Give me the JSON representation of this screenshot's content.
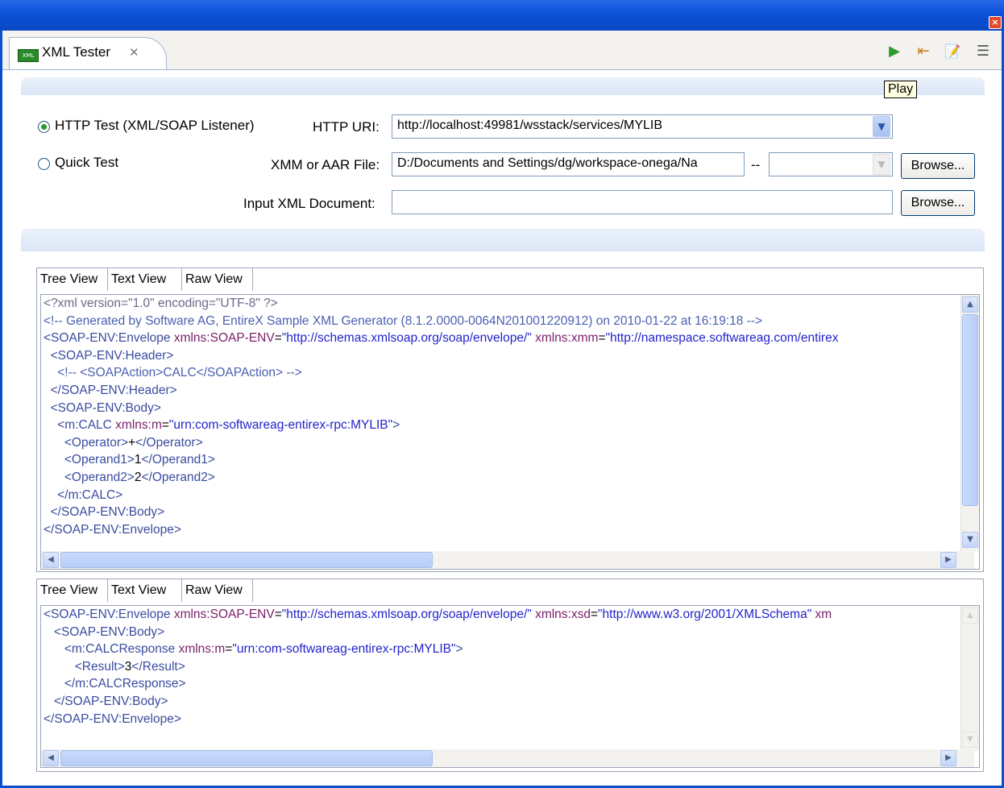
{
  "window": {
    "close_glyph": "×"
  },
  "tab": {
    "label": "XML Tester",
    "close_glyph": "✕",
    "icon": "xml-file-icon",
    "icon_text": "XML"
  },
  "toolbar": {
    "items": [
      {
        "name": "play-icon",
        "glyph": "▶"
      },
      {
        "name": "step-back-icon",
        "glyph": "⇤"
      },
      {
        "name": "export-icon",
        "glyph": "📝"
      },
      {
        "name": "layout-icon",
        "glyph": "☰"
      }
    ],
    "tooltip": "Play"
  },
  "form": {
    "radio_http": {
      "label": "HTTP Test (XML/SOAP Listener)",
      "checked": true
    },
    "radio_quick": {
      "label": "Quick Test",
      "checked": false
    },
    "http_uri_label": "HTTP URI:",
    "http_uri_value": "http://localhost:49981/wsstack/services/MYLIB",
    "xmm_label": "XMM or AAR File:",
    "xmm_value": "D:/Documents and Settings/dg/workspace-onega/Na",
    "xmm_separator": "--",
    "xmm_secondary_value": "",
    "input_xml_label": "Input XML Document:",
    "input_xml_value": "",
    "browse_label": "Browse..."
  },
  "request_panel": {
    "tabs": [
      "Tree View",
      "Text View",
      "Raw View"
    ],
    "lines": [
      [
        [
          "pi",
          "<?xml version=\"1.0\" encoding=\"UTF-8\" ?>"
        ]
      ],
      [
        [
          "com",
          "<!-- Generated by Software AG, EntireX Sample XML Generator (8.1.2.0000-0064N201001220912) on 2010-01-22 at 16:19:18 -->"
        ]
      ],
      [
        [
          "tag",
          "<SOAP-ENV:Envelope "
        ],
        [
          "att",
          "xmlns:SOAP-ENV"
        ],
        [
          "txt",
          "="
        ],
        [
          "val",
          "\"http://schemas.xmlsoap.org/soap/envelope/\""
        ],
        [
          "tag",
          " "
        ],
        [
          "att",
          "xmlns:xmm"
        ],
        [
          "txt",
          "="
        ],
        [
          "val",
          "\"http://namespace.softwareag.com/entirex"
        ]
      ],
      [
        [
          "tag",
          "  <SOAP-ENV:Header>"
        ]
      ],
      [
        [
          "com",
          "    <!-- <SOAPAction>CALC</SOAPAction> -->"
        ]
      ],
      [
        [
          "tag",
          "  </SOAP-ENV:Header>"
        ]
      ],
      [
        [
          "tag",
          "  <SOAP-ENV:Body>"
        ]
      ],
      [
        [
          "tag",
          "    <m:CALC "
        ],
        [
          "att",
          "xmlns:m"
        ],
        [
          "txt",
          "="
        ],
        [
          "val",
          "\"urn:com-softwareag-entirex-rpc:MYLIB\""
        ],
        [
          "tag",
          ">"
        ]
      ],
      [
        [
          "tag",
          "      <Operator>"
        ],
        [
          "txt",
          "+"
        ],
        [
          "tag",
          "</Operator>"
        ]
      ],
      [
        [
          "tag",
          "      <Operand1>"
        ],
        [
          "txt",
          "1"
        ],
        [
          "tag",
          "</Operand1>"
        ]
      ],
      [
        [
          "tag",
          "      <Operand2>"
        ],
        [
          "txt",
          "2"
        ],
        [
          "tag",
          "</Operand2>"
        ]
      ],
      [
        [
          "tag",
          "    </m:CALC>"
        ]
      ],
      [
        [
          "tag",
          "  </SOAP-ENV:Body>"
        ]
      ],
      [
        [
          "tag",
          "</SOAP-ENV:Envelope>"
        ]
      ]
    ]
  },
  "response_panel": {
    "tabs": [
      "Tree View",
      "Text View",
      "Raw View"
    ],
    "lines": [
      [
        [
          "tag",
          "<SOAP-ENV:Envelope "
        ],
        [
          "att",
          "xmlns:SOAP-ENV"
        ],
        [
          "txt",
          "="
        ],
        [
          "val",
          "\"http://schemas.xmlsoap.org/soap/envelope/\""
        ],
        [
          "tag",
          " "
        ],
        [
          "att",
          "xmlns:xsd"
        ],
        [
          "txt",
          "="
        ],
        [
          "val",
          "\"http://www.w3.org/2001/XMLSchema\""
        ],
        [
          "tag",
          " "
        ],
        [
          "att",
          "xm"
        ]
      ],
      [
        [
          "tag",
          "   <SOAP-ENV:Body>"
        ]
      ],
      [
        [
          "tag",
          "      <m:CALCResponse "
        ],
        [
          "att",
          "xmlns:m"
        ],
        [
          "txt",
          "="
        ],
        [
          "val",
          "\"urn:com-softwareag-entirex-rpc:MYLIB\""
        ],
        [
          "tag",
          ">"
        ]
      ],
      [
        [
          "tag",
          "         <Result>"
        ],
        [
          "txt",
          "3"
        ],
        [
          "tag",
          "</Result>"
        ]
      ],
      [
        [
          "tag",
          "      </m:CALCResponse>"
        ]
      ],
      [
        [
          "tag",
          "   </SOAP-ENV:Body>"
        ]
      ],
      [
        [
          "tag",
          "</SOAP-ENV:Envelope>"
        ]
      ]
    ]
  },
  "scroll": {
    "up": "▲",
    "down": "▼",
    "left": "◀",
    "right": "▶",
    "grip": "|||"
  }
}
